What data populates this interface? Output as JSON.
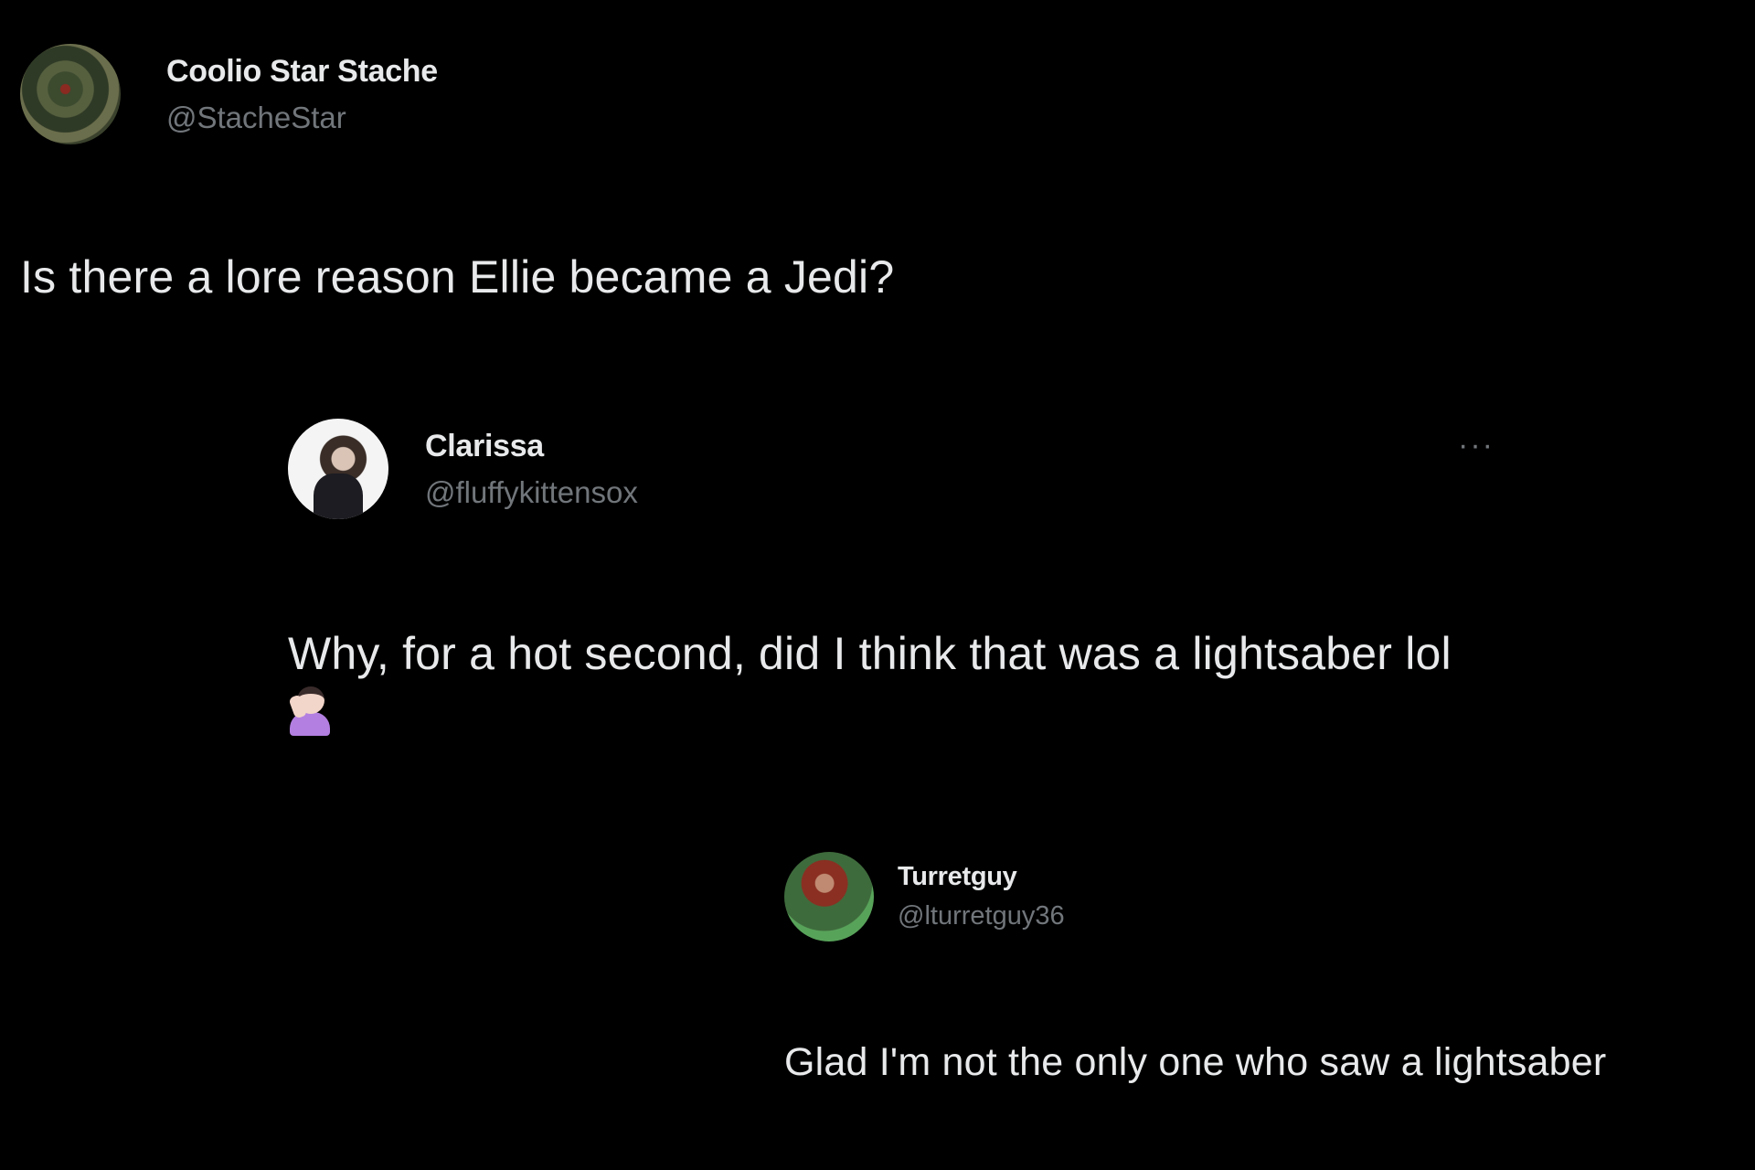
{
  "tweets": [
    {
      "display_name": "Coolio Star Stache",
      "handle": "@StacheStar",
      "text": "Is there a lore reason Ellie became a Jedi?"
    },
    {
      "display_name": "Clarissa",
      "handle": "@fluffykittensox",
      "more_icon": "more-options-icon",
      "more_label": "···",
      "text": "Why, for a hot second, did I think that was a lightsaber lol",
      "emoji": "woman-facepalming"
    },
    {
      "display_name": "Turretguy",
      "handle": "@lturretguy36",
      "text": "Glad I'm not the only one who saw a lightsaber"
    }
  ],
  "colors": {
    "background": "#000000",
    "text": "#e7e9ea",
    "handle": "#71767b"
  }
}
